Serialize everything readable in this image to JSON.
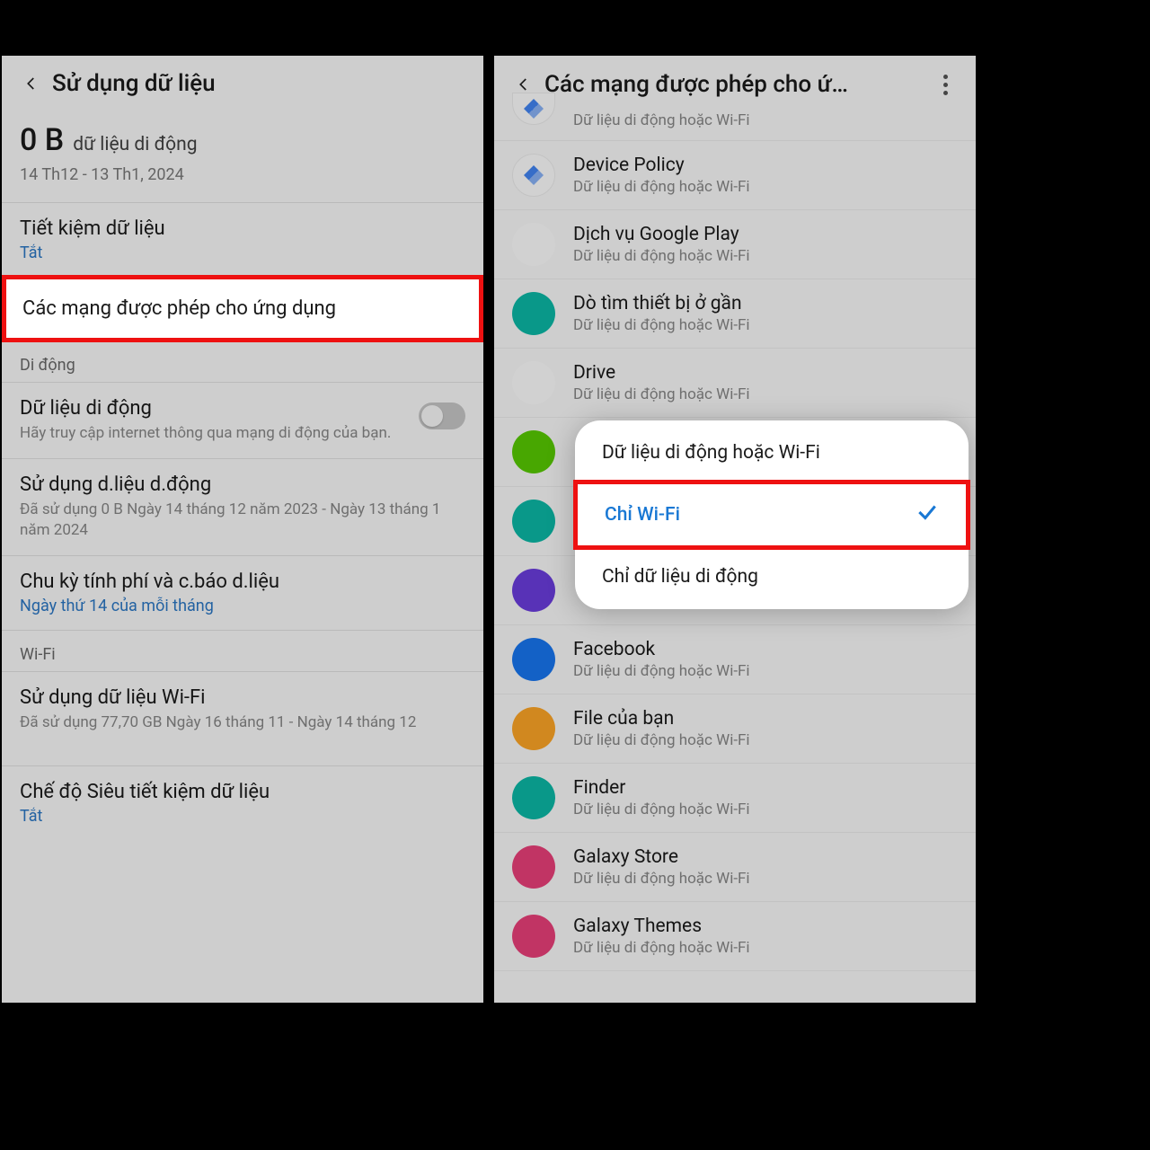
{
  "left": {
    "title": "Sử dụng dữ liệu",
    "usage_value": "0 B",
    "usage_label": "dữ liệu di động",
    "date_range": "14 Th12 - 13 Th1, 2024",
    "save_title": "Tiết kiệm dữ liệu",
    "save_status": "Tắt",
    "allowed_title": "Các mạng được phép cho ứng dụng",
    "sect_mobile": "Di động",
    "mobile_title": "Dữ liệu di động",
    "mobile_sub": "Hãy truy cập internet thông qua mạng di động của bạn.",
    "musage_title": "Sử dụng d.liệu d.động",
    "musage_sub": "Đã sử dụng 0 B Ngày 14 tháng 12 năm 2023 - Ngày 13 tháng 1 năm 2024",
    "cycle_title": "Chu kỳ tính phí và c.báo d.liệu",
    "cycle_sub": "Ngày thứ 14 của mỗi tháng",
    "sect_wifi": "Wi-Fi",
    "wusage_title": "Sử dụng dữ liệu Wi-Fi",
    "wusage_sub": "Đã sử dụng 77,70 GB Ngày 16 tháng 11 - Ngày 14 tháng 12",
    "ultra_title": "Chế độ Siêu tiết kiệm dữ liệu",
    "ultra_status": "Tắt"
  },
  "right": {
    "title": "Các mạng được phép cho ứ…",
    "sub": "Dữ liệu di động hoặc Wi-Fi",
    "apps": [
      {
        "name": "",
        "sub": "Dữ liệu di động hoặc Wi-Fi",
        "ic": "ic-google"
      },
      {
        "name": "Device Policy",
        "sub": "Dữ liệu di động hoặc Wi-Fi",
        "ic": "ic-google"
      },
      {
        "name": "Dịch vụ Google Play",
        "sub": "Dữ liệu di động hoặc Wi-Fi",
        "ic": "ic-play"
      },
      {
        "name": "Dò tìm thiết bị ở gần",
        "sub": "Dữ liệu di động hoặc Wi-Fi",
        "ic": "ic-radar"
      },
      {
        "name": "Drive",
        "sub": "Dữ liệu di động hoặc Wi-Fi",
        "ic": "ic-drive"
      },
      {
        "name": "",
        "sub": "",
        "ic": "ic-duo"
      },
      {
        "name": "",
        "sub": "",
        "ic": "ic-phone"
      },
      {
        "name": "",
        "sub": "",
        "ic": "ic-clock"
      },
      {
        "name": "Facebook",
        "sub": "Dữ liệu di động hoặc Wi-Fi",
        "ic": "ic-fb"
      },
      {
        "name": "File của bạn",
        "sub": "Dữ liệu di động hoặc Wi-Fi",
        "ic": "ic-file"
      },
      {
        "name": "Finder",
        "sub": "Dữ liệu di động hoặc Wi-Fi",
        "ic": "ic-finder"
      },
      {
        "name": "Galaxy Store",
        "sub": "Dữ liệu di động hoặc Wi-Fi",
        "ic": "ic-store"
      },
      {
        "name": "Galaxy Themes",
        "sub": "Dữ liệu di động hoặc Wi-Fi",
        "ic": "ic-theme"
      }
    ],
    "opt1": "Dữ liệu di động hoặc Wi-Fi",
    "opt2": "Chỉ Wi-Fi",
    "opt3": "Chỉ dữ liệu di động"
  }
}
